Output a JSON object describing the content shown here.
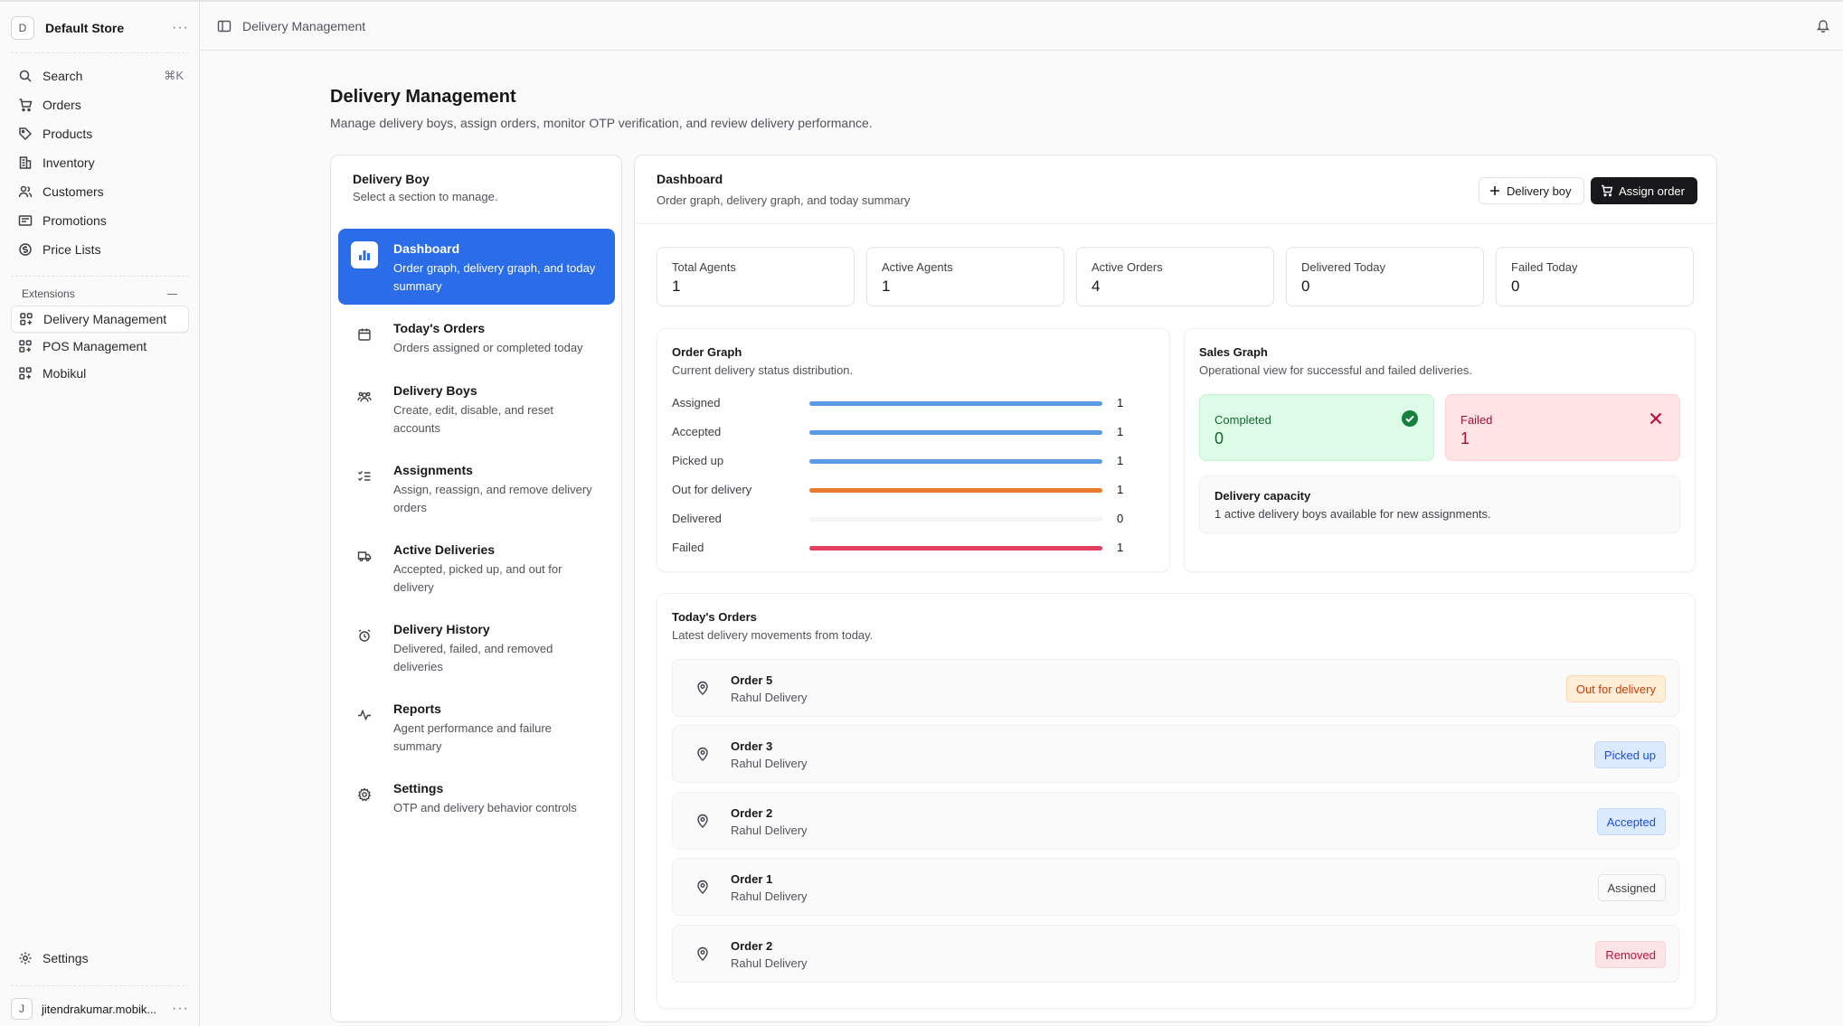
{
  "sidebar": {
    "store_initial": "D",
    "store_name": "Default Store",
    "search_label": "Search",
    "search_shortcut": "⌘K",
    "nav": [
      "Orders",
      "Products",
      "Inventory",
      "Customers",
      "Promotions",
      "Price Lists"
    ],
    "extensions_label": "Extensions",
    "extensions": [
      "Delivery Management",
      "POS Management",
      "Mobikul"
    ],
    "settings_label": "Settings",
    "user_initial": "J",
    "user_name": "jitendrakumar.mobik..."
  },
  "topbar": {
    "breadcrumb": "Delivery Management"
  },
  "page": {
    "title": "Delivery Management",
    "subtitle": "Manage delivery boys, assign orders, monitor OTP verification, and review delivery performance."
  },
  "menu": {
    "title": "Delivery Boy",
    "subtitle": "Select a section to manage.",
    "items": [
      {
        "title": "Dashboard",
        "desc": "Order graph, delivery graph, and today summary",
        "icon": "bar-chart-icon"
      },
      {
        "title": "Today's Orders",
        "desc": "Orders assigned or completed today",
        "icon": "calendar-icon"
      },
      {
        "title": "Delivery Boys",
        "desc": "Create, edit, disable, and reset accounts",
        "icon": "users-icon"
      },
      {
        "title": "Assignments",
        "desc": "Assign, reassign, and remove delivery orders",
        "icon": "list-check-icon"
      },
      {
        "title": "Active Deliveries",
        "desc": "Accepted, picked up, and out for delivery",
        "icon": "truck-icon"
      },
      {
        "title": "Delivery History",
        "desc": "Delivered, failed, and removed deliveries",
        "icon": "alarm-clock-icon"
      },
      {
        "title": "Reports",
        "desc": "Agent performance and failure summary",
        "icon": "activity-icon"
      },
      {
        "title": "Settings",
        "desc": "OTP and delivery behavior controls",
        "icon": "gear-icon"
      }
    ]
  },
  "dashboard": {
    "title": "Dashboard",
    "subtitle": "Order graph, delivery graph, and today summary",
    "add_delivery_boy_label": "Delivery boy",
    "assign_order_label": "Assign order",
    "stats": [
      {
        "label": "Total Agents",
        "value": "1"
      },
      {
        "label": "Active Agents",
        "value": "1"
      },
      {
        "label": "Active Orders",
        "value": "4"
      },
      {
        "label": "Delivered Today",
        "value": "0"
      },
      {
        "label": "Failed Today",
        "value": "0"
      }
    ],
    "order_graph": {
      "title": "Order Graph",
      "subtitle": "Current delivery status distribution.",
      "max": 1,
      "rows": [
        {
          "label": "Assigned",
          "value": 1,
          "color": "#5b9be6"
        },
        {
          "label": "Accepted",
          "value": 1,
          "color": "#5b9be6"
        },
        {
          "label": "Picked up",
          "value": 1,
          "color": "#5b9be6"
        },
        {
          "label": "Out for delivery",
          "value": 1,
          "color": "#ea7a2c"
        },
        {
          "label": "Delivered",
          "value": 0,
          "color": "#22c55e"
        },
        {
          "label": "Failed",
          "value": 1,
          "color": "#e2405e"
        }
      ]
    },
    "sales_graph": {
      "title": "Sales Graph",
      "subtitle": "Operational view for successful and failed deliveries.",
      "completed_label": "Completed",
      "completed_value": "0",
      "failed_label": "Failed",
      "failed_value": "1",
      "capacity_title": "Delivery capacity",
      "capacity_text": "1 active delivery boys available for new assignments."
    },
    "todays_orders": {
      "title": "Today's Orders",
      "subtitle": "Latest delivery movements from today.",
      "rows": [
        {
          "order": "Order 5",
          "agent": "Rahul Delivery",
          "status": "Out for delivery",
          "status_color": "#c2410c"
        },
        {
          "order": "Order 3",
          "agent": "Rahul Delivery",
          "status": "Picked up",
          "status_color": "#1d4ed8"
        },
        {
          "order": "Order 2",
          "agent": "Rahul Delivery",
          "status": "Accepted",
          "status_color": "#1d4ed8"
        },
        {
          "order": "Order 1",
          "agent": "Rahul Delivery",
          "status": "Assigned",
          "status_color": "#3f3f46"
        },
        {
          "order": "Order 2",
          "agent": "Rahul Delivery",
          "status": "Removed",
          "status_color": "#be123c"
        }
      ]
    }
  }
}
